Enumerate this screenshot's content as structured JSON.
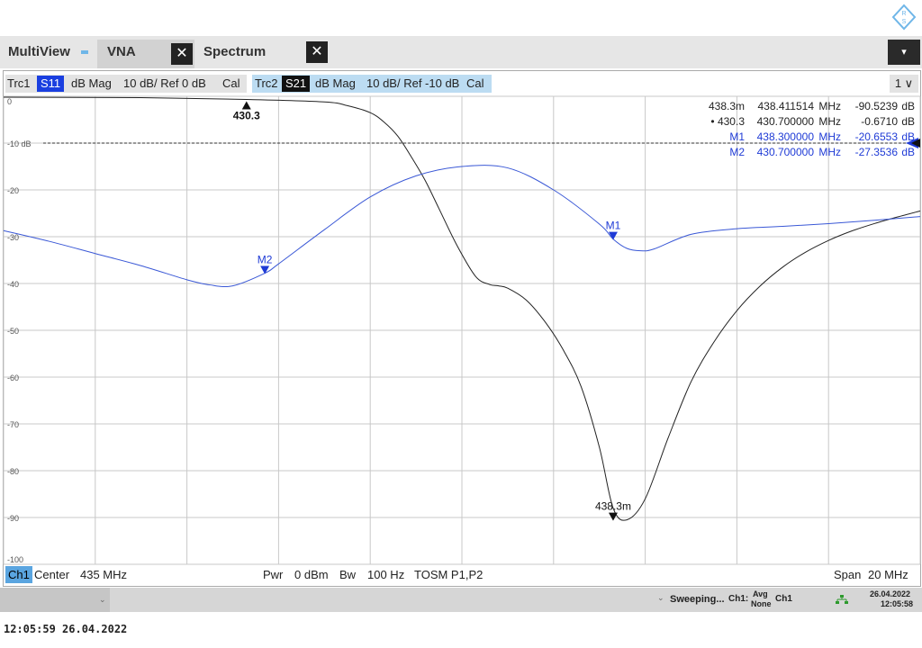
{
  "tabs": {
    "multiview": "MultiView",
    "vna": "VNA",
    "spectrum": "Spectrum",
    "close_glyph": "✕",
    "menu_glyph": "▾"
  },
  "tracebar": {
    "trc1": "Trc1",
    "s11": "S11",
    "trc1_format": "dB Mag",
    "trc1_scale": "10 dB/ Ref 0 dB",
    "trc1_cal": "Cal",
    "trc2": "Trc2",
    "s21": "S21",
    "trc2_format": "dB Mag",
    "trc2_scale": "10 dB/ Ref -10 dB",
    "trc2_cal": "Cal",
    "window_num": "1"
  },
  "chart_data": {
    "type": "line",
    "xlim": [
      425,
      445
    ],
    "ylim": [
      -100,
      0
    ],
    "grid": true,
    "y_tick_labels": [
      "0",
      "-10 dB",
      "-20",
      "-30",
      "-40",
      "-50",
      "-60",
      "-70",
      "-80",
      "-90",
      "-100"
    ],
    "reference_line": {
      "trace": "Trc2",
      "value": -10
    },
    "series": [
      {
        "name": "Trc1 S11",
        "color": "#222222",
        "x": [
          425,
          428,
          430.3,
          432,
          432.5,
          433,
          433.3,
          433.6,
          433.9,
          434.2,
          434.5,
          434.9,
          435.3,
          435.6,
          435.8,
          436,
          436.4,
          436.8,
          437.2,
          437.6,
          438,
          438.3,
          438.6,
          439,
          439.5,
          440,
          440.5,
          441,
          441.5,
          442,
          442.5,
          443,
          443.5,
          444,
          444.5,
          445
        ],
        "y": [
          -0.2,
          -0.3,
          -0.67,
          -1.2,
          -2,
          -3.5,
          -5.5,
          -8.5,
          -13,
          -18,
          -24,
          -32,
          -38.5,
          -40.2,
          -40.5,
          -41,
          -43.5,
          -48,
          -54,
          -62,
          -75,
          -88,
          -90.5,
          -86,
          -73,
          -61,
          -52.5,
          -45.8,
          -40.6,
          -36.5,
          -33.3,
          -30.8,
          -28.8,
          -27.2,
          -25.8,
          -24.5
        ]
      },
      {
        "name": "Trc2 S21",
        "color": "#3a58d6",
        "x": [
          425,
          426,
          427,
          428,
          429,
          429.5,
          430,
          430.7,
          431,
          432,
          433,
          434,
          435,
          436,
          437,
          438,
          438.3,
          438.6,
          438.9,
          439.2,
          440,
          441,
          442,
          443,
          444,
          445
        ],
        "y": [
          -28.7,
          -31,
          -33.6,
          -36.2,
          -39.2,
          -40.3,
          -40.5,
          -37.8,
          -35.8,
          -28.5,
          -21.5,
          -17,
          -15,
          -15.3,
          -20,
          -27.3,
          -30.5,
          -32.5,
          -33,
          -32.6,
          -29.5,
          -28.3,
          -27.8,
          -27.2,
          -26.5,
          -25.7
        ]
      }
    ],
    "markers": [
      {
        "label": "430.3",
        "trace": "Trc1",
        "x": 430.3,
        "y": -0.67,
        "color": "#111111",
        "pointer": "up"
      },
      {
        "label": "438.3m",
        "trace": "Trc1",
        "x": 438.3,
        "y": -90.5,
        "color": "#111111",
        "pointer": "down"
      },
      {
        "label": "M1",
        "trace": "Trc2",
        "x": 438.3,
        "y": -30.5,
        "color": "#1f3bd6",
        "pointer": "down"
      },
      {
        "label": "M2",
        "trace": "Trc2",
        "x": 430.7,
        "y": -37.8,
        "color": "#1f3bd6",
        "pointer": "down"
      }
    ],
    "marker_table": [
      {
        "name": "438.3m",
        "freq": "438.411514",
        "unit": "MHz",
        "value": "-90.5239",
        "vunit": "dB",
        "color": "#222222"
      },
      {
        "name": "• 430.3",
        "freq": "430.700000",
        "unit": "MHz",
        "value": "-0.6710",
        "vunit": "dB",
        "color": "#222222"
      },
      {
        "name": "M1",
        "freq": "438.300000",
        "unit": "MHz",
        "value": "-20.6553",
        "vunit": "dB",
        "color": "#1f3bd6"
      },
      {
        "name": "M2",
        "freq": "430.700000",
        "unit": "MHz",
        "value": "-27.3536",
        "vunit": "dB",
        "color": "#1f3bd6"
      }
    ]
  },
  "statusbar": {
    "channel": "Ch1",
    "center_label": "Center",
    "center_value": "435 MHz",
    "pwr_label": "Pwr",
    "pwr_value": "0 dBm",
    "bw_label": "Bw",
    "bw_value": "100 Hz",
    "cal": "TOSM P1,P2",
    "span_label": "Span",
    "span_value": "20 MHz"
  },
  "bottombar": {
    "sweeping": "Sweeping...",
    "ch_label": "Ch1:",
    "avg": "Avg",
    "avg_value": "None",
    "avg_ch": "Ch1",
    "date": "26.04.2022",
    "time": "12:05:58"
  },
  "footer": {
    "timestamp": "12:05:59  26.04.2022"
  }
}
